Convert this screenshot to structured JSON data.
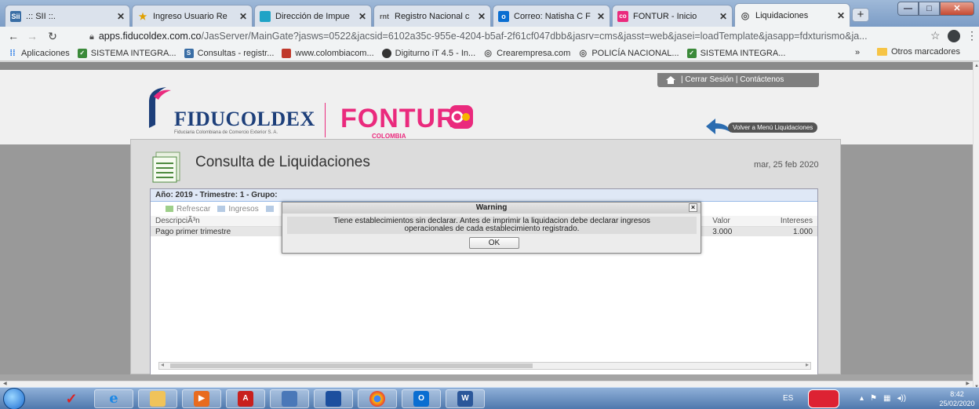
{
  "browser": {
    "tabs": [
      {
        "label": ".:: SII ::.",
        "favicon": "sii-icon",
        "favicon_text": "Sii"
      },
      {
        "label": "Ingreso Usuario Re",
        "favicon": "star-icon",
        "favicon_text": ""
      },
      {
        "label": "Dirección de Impue",
        "favicon": "dian-icon",
        "favicon_text": ""
      },
      {
        "label": "Registro Nacional c",
        "favicon": "rnt-icon",
        "favicon_text": "rnt"
      },
      {
        "label": "Correo: Natisha C F",
        "favicon": "outlook-icon",
        "favicon_text": "o"
      },
      {
        "label": "FONTUR - Inicio",
        "favicon": "fontur-icon",
        "favicon_text": "co"
      },
      {
        "label": "Liquidaciones",
        "favicon": "globe-icon",
        "favicon_text": ""
      }
    ],
    "active_tab": 6,
    "new_tab_label": "+",
    "window_controls": {
      "minimize": "—",
      "maximize": "□",
      "close": "✕"
    },
    "url_host": "apps.fiducoldex.com.co",
    "url_path": "/JasServer/MainGate?jasws=0522&jacsid=6102a35c-955e-4204-b5af-2f61cf047dbb&jasrv=cms&jasst=web&jasei=loadTemplate&jasapp=fdxturismo&ja...",
    "bookmarks": [
      {
        "label": "Aplicaciones",
        "icon": "apps-grid-icon"
      },
      {
        "label": "SISTEMA INTEGRA...",
        "icon": "check-icon"
      },
      {
        "label": "Consultas - registr...",
        "icon": "sii-icon"
      },
      {
        "label": "www.colombiacom...",
        "icon": "colombia-icon"
      },
      {
        "label": "Digiturno iT 4.5 - In...",
        "icon": "digiturno-icon"
      },
      {
        "label": "Crearempresa.com",
        "icon": "globe-icon"
      },
      {
        "label": "POLICÍA NACIONAL...",
        "icon": "globe-icon"
      },
      {
        "label": "SISTEMA INTEGRA...",
        "icon": "check-icon"
      }
    ],
    "bookmarks_more": "»",
    "other_bookmarks": "Otros marcadores"
  },
  "page": {
    "user_bar": "| Cerrar Sesión | Contáctenos",
    "fiducoldex_name": "FIDUCOLDEX",
    "fiducoldex_sub": "Fiduciaria Colombiana de Comercio Exterior S. A.",
    "fontur_name": "FONTUR",
    "fontur_sub": "COLOMBIA",
    "volver": "Volver a Menú Liquidaciones",
    "title": "Consulta de Liquidaciones",
    "date": "mar, 25 feb 2020",
    "grid_header": "Año: 2019 - Trimestre: 1 - Grupo:",
    "toolbar": {
      "refresh": "Refrescar",
      "ingresos": "Ingresos"
    },
    "columns": {
      "desc": "DescripciÃ³n",
      "valor": "Valor",
      "intereses": "Intereses"
    },
    "rows": [
      {
        "desc": "Pago primer trimestre",
        "valor": "3.000",
        "intereses": "1.000"
      }
    ]
  },
  "modal": {
    "title": "Warning",
    "close": "×",
    "message_line1": "Tiene establecimientos sin declarar. Antes de imprimir la liquidacion debe declarar ingresos",
    "message_line2": "operacionales de cada establecimiento registrado.",
    "ok_label": "OK"
  },
  "taskbar": {
    "apps": [
      "windows-start",
      "acrobat-check-icon",
      "internet-explorer-icon",
      "file-explorer-icon",
      "media-player-icon",
      "adobe-reader-icon",
      "network-icon",
      "remote-desktop-icon",
      "chrome-icon",
      "outlook-icon",
      "word-icon"
    ],
    "language": "ES",
    "time": "8:42",
    "date": "25/02/2020"
  },
  "colors": {
    "fontur_pink": "#ea2a7d",
    "fiducoldex_blue": "#1d3f7a",
    "taskbar": "#4f78ad"
  }
}
